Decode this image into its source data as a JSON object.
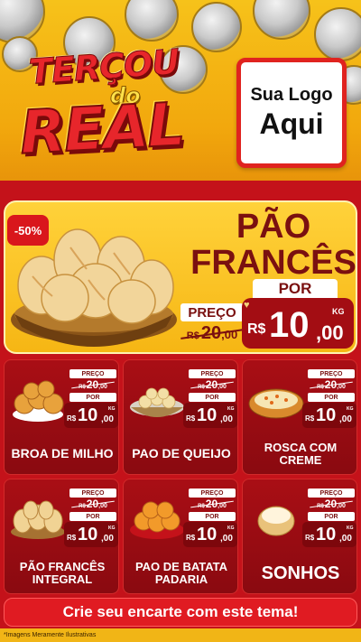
{
  "header": {
    "brand_line1": "TERÇOU",
    "brand_do": "do",
    "brand_line2": "REAL",
    "logo_line1": "Sua Logo",
    "logo_line2": "Aqui"
  },
  "featured": {
    "badge": "-50%",
    "title_line1": "PÃO",
    "title_line2": "FRANCÊS",
    "preco_label": "PREÇO",
    "old_currency": "R$",
    "old_int": "20",
    "old_cents": ",00",
    "por_label": "POR",
    "currency": "R$",
    "price_int": "10",
    "price_cents": ",00",
    "unit": "KG"
  },
  "products": [
    {
      "name": "BROA DE MILHO",
      "preco_label": "PREÇO",
      "old_currency": "R$",
      "old_int": "20",
      "old_cents": ",00",
      "por_label": "POR",
      "currency": "R$",
      "price_int": "10",
      "price_cents": ",00",
      "unit": "KG"
    },
    {
      "name": "PAO DE QUEIJO",
      "preco_label": "PREÇO",
      "old_currency": "R$",
      "old_int": "20",
      "old_cents": ",00",
      "por_label": "POR",
      "currency": "R$",
      "price_int": "10",
      "price_cents": ",00",
      "unit": "KG"
    },
    {
      "name": "ROSCA COM CREME",
      "preco_label": "PREÇO",
      "old_currency": "R$",
      "old_int": "20",
      "old_cents": ",00",
      "por_label": "POR",
      "currency": "R$",
      "price_int": "10",
      "price_cents": ",00",
      "unit": "KG"
    },
    {
      "name": "PÃO FRANCÊS INTEGRAL",
      "preco_label": "PREÇO",
      "old_currency": "R$",
      "old_int": "20",
      "old_cents": ",00",
      "por_label": "POR",
      "currency": "R$",
      "price_int": "10",
      "price_cents": ",00",
      "unit": "KG"
    },
    {
      "name": "PAO DE BATATA PADARIA",
      "preco_label": "PREÇO",
      "old_currency": "R$",
      "old_int": "20",
      "old_cents": ",00",
      "por_label": "POR",
      "currency": "R$",
      "price_int": "10",
      "price_cents": ",00",
      "unit": "KG"
    },
    {
      "name": "SONHOS",
      "preco_label": "PREÇO",
      "old_currency": "R$",
      "old_int": "20",
      "old_cents": ",00",
      "por_label": "POR",
      "currency": "R$",
      "price_int": "10",
      "price_cents": ",00",
      "unit": "KG"
    }
  ],
  "footer": {
    "cta": "Crie seu encarte com este tema!",
    "disclaimer": "*Imagens Meramente Ilustrativas"
  },
  "colors": {
    "background_red": "#c4121a",
    "header_yellow": "#f6c21a",
    "card_red": "#a90e15",
    "price_dark_red": "#7d070c"
  }
}
